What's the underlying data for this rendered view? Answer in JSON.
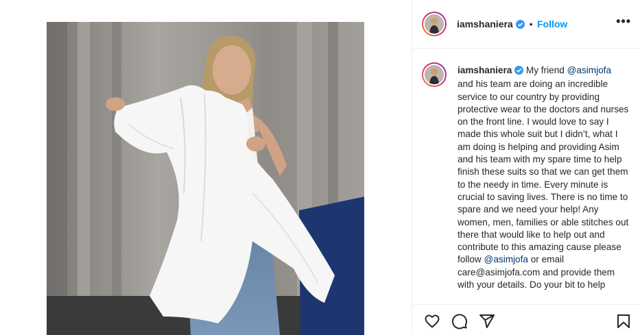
{
  "post": {
    "username": "iamshaniera",
    "follow_label": "Follow",
    "separator": "•",
    "more_label": "•••",
    "caption": {
      "username": "iamshaniera",
      "text_1": "My friend ",
      "mention_1": "@asimjofa",
      "text_2": " and his team are doing an incredible service to our country by providing protective wear to the doctors and nurses on the front line. I would love to say I made this whole suit but I didn’t, what I am doing is helping and providing Asim and his team with my spare time to help finish these suits so that we can get them to the needy in time. Every minute is crucial to saving lives. There is no time to spare and we need your help! Any women, men, families or able stitches out there that would like to help out and contribute to this amazing cause please follow ",
      "mention_2": "@asimjofa",
      "text_3": " or email care@asimjofa.com and provide them with your details. Do your bit to help"
    }
  },
  "icons": {
    "verified": "verified-badge-icon",
    "like": "heart-icon",
    "comment": "comment-icon",
    "share": "paper-plane-icon",
    "save": "bookmark-icon"
  },
  "colors": {
    "accent": "#0095f6",
    "verified": "#3897f0",
    "mention": "#00376b",
    "text": "#262626",
    "border": "#efefef"
  }
}
